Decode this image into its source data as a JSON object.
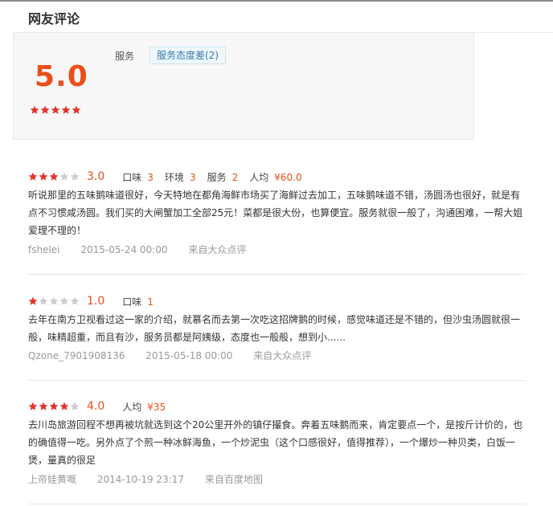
{
  "section_title": "网友评论",
  "summary": {
    "score": "5.0",
    "stars": 5,
    "tag_label": "服务",
    "tag": "服务态度差(2)"
  },
  "colors": {
    "accent": "#ea4f1b",
    "star_on": "#e4322a",
    "star_off": "#cccccc"
  },
  "reviews": [
    {
      "stars": 3,
      "score": "3.0",
      "attrs": [
        {
          "label": "口味",
          "value": "3"
        },
        {
          "label": "环境",
          "value": "3"
        },
        {
          "label": "服务",
          "value": "2"
        },
        {
          "label": "人均",
          "value": "¥60.0"
        }
      ],
      "lines": [
        "听说那里的五味鹅味道很好，今天特地在都角海鲜市场买了海鲜过去加工，五味鹅味道不错，汤圆汤也很好，就是有",
        "点不习惯咸汤圆。我们买的大闸蟹加工全部25元！菜都是很大份，也算便宜。服务就很一般了，沟通困难，一帮大姐",
        "爱理不理的！"
      ],
      "user": "fshelei",
      "time": "2015-05-24 00:00",
      "source": "来自大众点评"
    },
    {
      "stars": 1,
      "score": "1.0",
      "attrs": [
        {
          "label": "口味",
          "value": "1"
        }
      ],
      "lines": [
        "去年在南方卫视看过这一家的介绍，就慕名而去第一次吃这招牌鹅的时候，感觉味道还是不错的，但沙虫汤圆就很一",
        "般，味精超重，而且有沙，服务员都是阿姨级，态度也一般般，想到小......"
      ],
      "user": "Qzone_7901908136",
      "time": "2015-05-18 00:00",
      "source": "来自大众点评"
    },
    {
      "stars": 4,
      "score": "4.0",
      "attrs": [
        {
          "label": "人均",
          "value": "¥35"
        }
      ],
      "lines": [
        "去川岛旅游回程不想再被坑就选到这个20公里开外的镇仔撮食。奔着五味鹅而来，肯定要点一个，是按斤计价的，也",
        "的确值得一吃。另外点了个煎一种冰鲜海鱼，一个炒泥虫（这个口感很好，值得推荐），一个爆炒一种贝类，白饭一",
        "煲，量真的很足"
      ],
      "user": "上帝娃黄嘅",
      "time": "2014-10-19 23:17",
      "source": "来自百度地图"
    }
  ]
}
